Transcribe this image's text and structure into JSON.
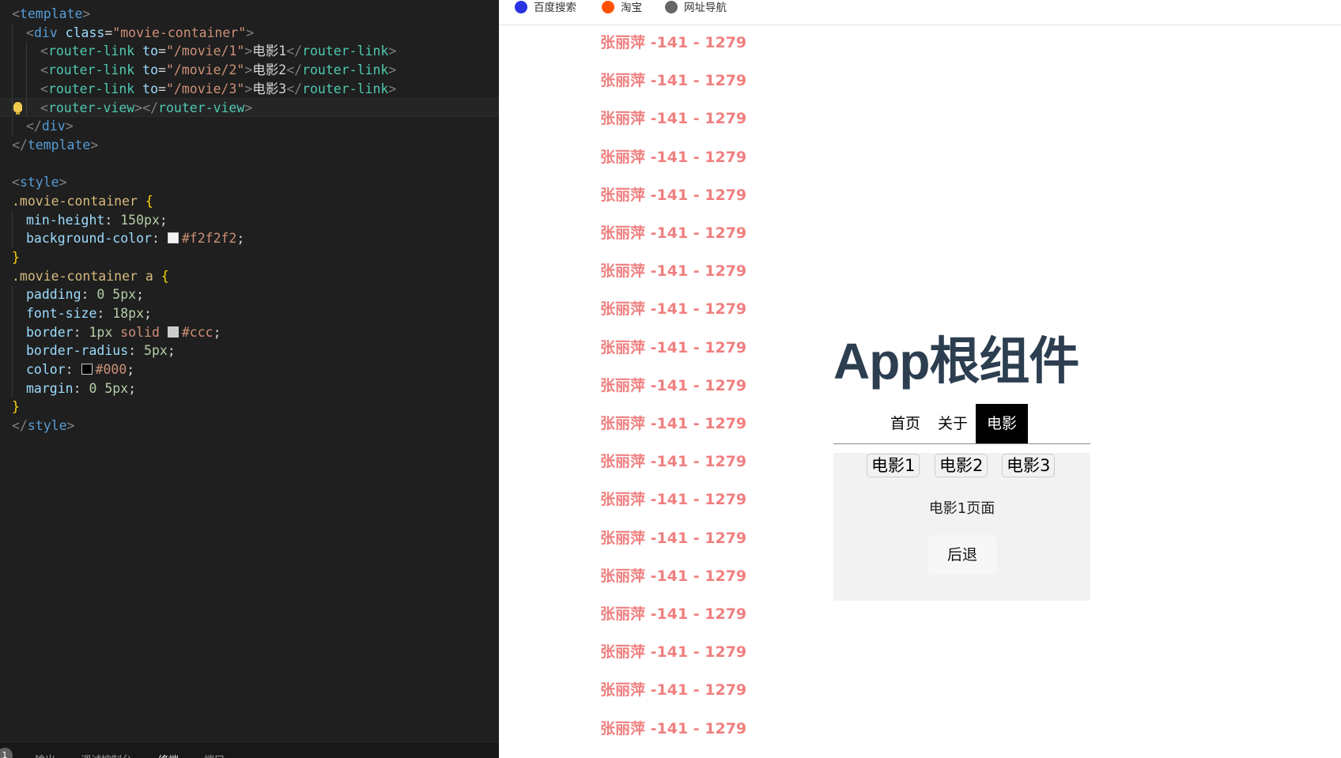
{
  "editor": {
    "lines": [
      {
        "indent": 0,
        "tokens": [
          {
            "t": "<",
            "c": "punc"
          },
          {
            "t": "template",
            "c": "tag"
          },
          {
            "t": ">",
            "c": "punc"
          }
        ]
      },
      {
        "indent": 1,
        "tokens": [
          {
            "t": "<",
            "c": "punc"
          },
          {
            "t": "div",
            "c": "tag"
          },
          {
            "t": " class",
            "c": "attr"
          },
          {
            "t": "=",
            "c": "text"
          },
          {
            "t": "\"movie-container\"",
            "c": "str"
          },
          {
            "t": ">",
            "c": "punc"
          }
        ]
      },
      {
        "indent": 2,
        "tokens": [
          {
            "t": "<",
            "c": "punc"
          },
          {
            "t": "router-link",
            "c": "comp"
          },
          {
            "t": " to",
            "c": "attr"
          },
          {
            "t": "=",
            "c": "text"
          },
          {
            "t": "\"/movie/1\"",
            "c": "str"
          },
          {
            "t": ">",
            "c": "punc"
          },
          {
            "t": "电影1",
            "c": "text"
          },
          {
            "t": "</",
            "c": "punc"
          },
          {
            "t": "router-link",
            "c": "comp"
          },
          {
            "t": ">",
            "c": "punc"
          }
        ]
      },
      {
        "indent": 2,
        "tokens": [
          {
            "t": "<",
            "c": "punc"
          },
          {
            "t": "router-link",
            "c": "comp"
          },
          {
            "t": " to",
            "c": "attr"
          },
          {
            "t": "=",
            "c": "text"
          },
          {
            "t": "\"/movie/2\"",
            "c": "str"
          },
          {
            "t": ">",
            "c": "punc"
          },
          {
            "t": "电影2",
            "c": "text"
          },
          {
            "t": "</",
            "c": "punc"
          },
          {
            "t": "router-link",
            "c": "comp"
          },
          {
            "t": ">",
            "c": "punc"
          }
        ]
      },
      {
        "indent": 2,
        "tokens": [
          {
            "t": "<",
            "c": "punc"
          },
          {
            "t": "router-link",
            "c": "comp"
          },
          {
            "t": " to",
            "c": "attr"
          },
          {
            "t": "=",
            "c": "text"
          },
          {
            "t": "\"/movie/3\"",
            "c": "str"
          },
          {
            "t": ">",
            "c": "punc"
          },
          {
            "t": "电影3",
            "c": "text"
          },
          {
            "t": "</",
            "c": "punc"
          },
          {
            "t": "router-link",
            "c": "comp"
          },
          {
            "t": ">",
            "c": "punc"
          }
        ]
      },
      {
        "indent": 2,
        "current": true,
        "bulb": true,
        "tokens": [
          {
            "t": "<",
            "c": "punc"
          },
          {
            "t": "router-view",
            "c": "comp"
          },
          {
            "t": "></",
            "c": "punc"
          },
          {
            "t": "router-view",
            "c": "comp"
          },
          {
            "t": ">",
            "c": "punc"
          }
        ]
      },
      {
        "indent": 1,
        "tokens": [
          {
            "t": "</",
            "c": "punc"
          },
          {
            "t": "div",
            "c": "tag"
          },
          {
            "t": ">",
            "c": "punc"
          }
        ]
      },
      {
        "indent": 0,
        "tokens": [
          {
            "t": "</",
            "c": "punc"
          },
          {
            "t": "template",
            "c": "tag"
          },
          {
            "t": ">",
            "c": "punc"
          }
        ]
      },
      {
        "indent": 0,
        "tokens": []
      },
      {
        "indent": 0,
        "tokens": [
          {
            "t": "<",
            "c": "punc"
          },
          {
            "t": "style",
            "c": "tag"
          },
          {
            "t": ">",
            "c": "punc"
          }
        ]
      },
      {
        "indent": 0,
        "tokens": [
          {
            "t": ".movie-container",
            "c": "sel"
          },
          {
            "t": " {",
            "c": "brace"
          }
        ]
      },
      {
        "indent": 1,
        "tokens": [
          {
            "t": "min-height",
            "c": "prop"
          },
          {
            "t": ": ",
            "c": "text"
          },
          {
            "t": "150px",
            "c": "num"
          },
          {
            "t": ";",
            "c": "text"
          }
        ]
      },
      {
        "indent": 1,
        "tokens": [
          {
            "t": "background-color",
            "c": "prop"
          },
          {
            "t": ": ",
            "c": "text"
          },
          {
            "swatch": "#f2f2f2"
          },
          {
            "t": "#f2f2f2",
            "c": "val"
          },
          {
            "t": ";",
            "c": "text"
          }
        ]
      },
      {
        "indent": 0,
        "tokens": [
          {
            "t": "}",
            "c": "brace"
          }
        ]
      },
      {
        "indent": 0,
        "tokens": [
          {
            "t": ".movie-container a",
            "c": "sel"
          },
          {
            "t": " {",
            "c": "brace"
          }
        ]
      },
      {
        "indent": 1,
        "tokens": [
          {
            "t": "padding",
            "c": "prop"
          },
          {
            "t": ": ",
            "c": "text"
          },
          {
            "t": "0 5px",
            "c": "num"
          },
          {
            "t": ";",
            "c": "text"
          }
        ]
      },
      {
        "indent": 1,
        "tokens": [
          {
            "t": "font-size",
            "c": "prop"
          },
          {
            "t": ": ",
            "c": "text"
          },
          {
            "t": "18px",
            "c": "num"
          },
          {
            "t": ";",
            "c": "text"
          }
        ]
      },
      {
        "indent": 1,
        "tokens": [
          {
            "t": "border",
            "c": "prop"
          },
          {
            "t": ": ",
            "c": "text"
          },
          {
            "t": "1px",
            "c": "num"
          },
          {
            "t": " solid ",
            "c": "val"
          },
          {
            "swatch": "#cccccc"
          },
          {
            "t": "#ccc",
            "c": "val"
          },
          {
            "t": ";",
            "c": "text"
          }
        ]
      },
      {
        "indent": 1,
        "tokens": [
          {
            "t": "border-radius",
            "c": "prop"
          },
          {
            "t": ": ",
            "c": "text"
          },
          {
            "t": "5px",
            "c": "num"
          },
          {
            "t": ";",
            "c": "text"
          }
        ]
      },
      {
        "indent": 1,
        "tokens": [
          {
            "t": "color",
            "c": "prop"
          },
          {
            "t": ": ",
            "c": "text"
          },
          {
            "swatch": "#000000"
          },
          {
            "t": "#000",
            "c": "val"
          },
          {
            "t": ";",
            "c": "text"
          }
        ]
      },
      {
        "indent": 1,
        "tokens": [
          {
            "t": "margin",
            "c": "prop"
          },
          {
            "t": ": ",
            "c": "text"
          },
          {
            "t": "0 5px",
            "c": "num"
          },
          {
            "t": ";",
            "c": "text"
          }
        ]
      },
      {
        "indent": 0,
        "tokens": [
          {
            "t": "}",
            "c": "brace"
          }
        ]
      },
      {
        "indent": 0,
        "tokens": [
          {
            "t": "</",
            "c": "punc"
          },
          {
            "t": "style",
            "c": "tag"
          },
          {
            "t": ">",
            "c": "punc"
          }
        ]
      }
    ]
  },
  "panel": {
    "badge": "1",
    "tabs": [
      {
        "label": "输出",
        "active": false
      },
      {
        "label": "调试控制台",
        "active": false
      },
      {
        "label": "终端",
        "active": true
      },
      {
        "label": "端口",
        "active": false
      }
    ]
  },
  "bookmarks": [
    {
      "label": "百度搜索",
      "icon": "baidu-icon"
    },
    {
      "label": "淘宝",
      "icon": "taobao-icon"
    },
    {
      "label": "网址导航",
      "icon": "globe-icon"
    }
  ],
  "log_items": [
    "张丽萍 -141 - 1279",
    "张丽萍 -141 - 1279",
    "张丽萍 -141 - 1279",
    "张丽萍 -141 - 1279",
    "张丽萍 -141 - 1279",
    "张丽萍 -141 - 1279",
    "张丽萍 -141 - 1279",
    "张丽萍 -141 - 1279",
    "张丽萍 -141 - 1279",
    "张丽萍 -141 - 1279",
    "张丽萍 -141 - 1279",
    "张丽萍 -141 - 1279",
    "张丽萍 -141 - 1279",
    "张丽萍 -141 - 1279",
    "张丽萍 -141 - 1279",
    "张丽萍 -141 - 1279",
    "张丽萍 -141 - 1279",
    "张丽萍 -141 - 1279",
    "张丽萍 -141 - 1279"
  ],
  "app": {
    "title": "App根组件",
    "nav": [
      {
        "label": "首页",
        "active": false
      },
      {
        "label": "关于",
        "active": false
      },
      {
        "label": "电影",
        "active": true
      }
    ],
    "movie_links": [
      "电影1",
      "电影2",
      "电影3"
    ],
    "movie_page": "电影1页面",
    "back_label": "后退"
  },
  "colors": {
    "editor_bg": "#1f1f1f",
    "log_text": "#f07f7f",
    "app_title": "#2c3e50",
    "movie_container_bg": "#f2f2f2",
    "nav_active_bg": "#000000"
  }
}
